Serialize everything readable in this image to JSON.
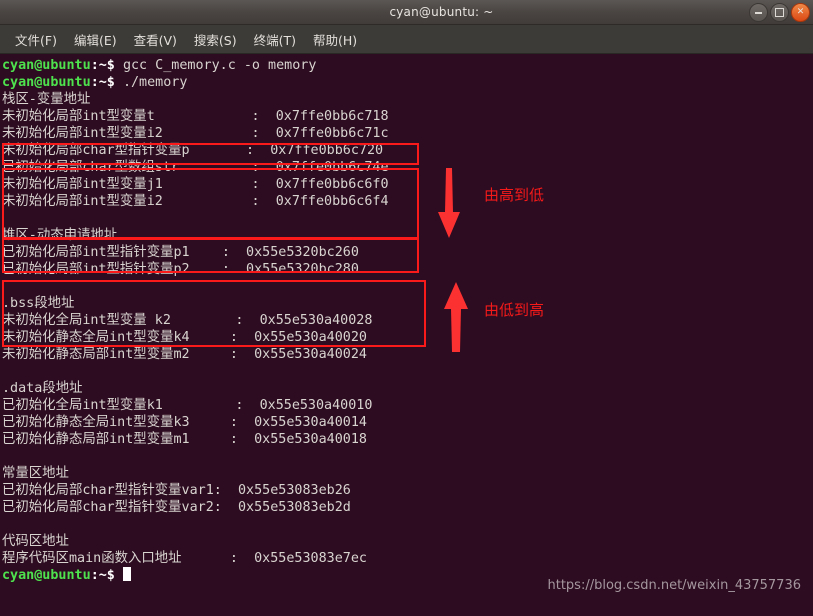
{
  "window": {
    "title": "cyan@ubuntu: ~",
    "buttons": [
      {
        "name": "minimize-button",
        "icon": "minimize-icon"
      },
      {
        "name": "maximize-button",
        "icon": "maximize-icon"
      },
      {
        "name": "close-button",
        "icon": "close-icon"
      }
    ]
  },
  "menubar": {
    "items": [
      {
        "label": "文件(F)",
        "name": "menu-file"
      },
      {
        "label": "编辑(E)",
        "name": "menu-edit"
      },
      {
        "label": "查看(V)",
        "name": "menu-view"
      },
      {
        "label": "搜索(S)",
        "name": "menu-search"
      },
      {
        "label": "终端(T)",
        "name": "menu-terminal"
      },
      {
        "label": "帮助(H)",
        "name": "menu-help"
      }
    ]
  },
  "terminal": {
    "prompt_user": "cyan@ubuntu",
    "prompt_tail": ":~$ ",
    "commands": {
      "compile": "gcc C_memory.c -o memory",
      "run": "./memory"
    },
    "lines": [
      "栈区-变量地址",
      "未初始化局部int型变量t            :  0x7ffe0bb6c718",
      "未初始化局部int型变量i2           :  0x7ffe0bb6c71c",
      "未初始化局部char型指针变量p       :  0x7ffe0bb6c720",
      "已初始化局部char型数组str         :  0x7ffe0bb6c74e",
      "未初始化局部int型变量j1           :  0x7ffe0bb6c6f0",
      "未初始化局部int型变量i2           :  0x7ffe0bb6c6f4",
      "",
      "堆区-动态申请地址",
      "已初始化局部int型指针变量p1    :  0x55e5320bc260",
      "已初始化局部int型指针变量p2    :  0x55e5320bc280",
      "",
      ".bss段地址",
      "未初始化全局int型变量 k2        :  0x55e530a40028",
      "未初始化静态全局int型变量k4     :  0x55e530a40020",
      "未初始化静态局部int型变量m2     :  0x55e530a40024",
      "",
      ".data段地址",
      "已初始化全局int型变量k1         :  0x55e530a40010",
      "已初始化静态全局int型变量k3     :  0x55e530a40014",
      "已初始化静态局部int型变量m1     :  0x55e530a40018",
      "",
      "常量区地址",
      "已初始化局部char型指针变量var1:  0x55e53083eb26",
      "已初始化局部char型指针变量var2:  0x55e53083eb2d",
      "",
      "代码区地址",
      "程序代码区main函数入口地址      :  0x55e53083e7ec"
    ]
  },
  "annotations": {
    "color": "#fb1a1a",
    "labels": [
      {
        "text": "由高到低",
        "name": "annotation-high-to-low"
      },
      {
        "text": "由低到高",
        "name": "annotation-low-to-high"
      }
    ],
    "arrows": [
      {
        "direction": "down",
        "name": "down-arrow-icon"
      },
      {
        "direction": "up",
        "name": "up-arrow-icon"
      }
    ],
    "boxes": [
      {
        "name": "box-stack-heading"
      },
      {
        "name": "box-stack-group-1"
      },
      {
        "name": "box-stack-group-2"
      },
      {
        "name": "box-heap-section"
      }
    ]
  },
  "watermark": {
    "text": "https://blog.csdn.net/weixin_43757736"
  }
}
